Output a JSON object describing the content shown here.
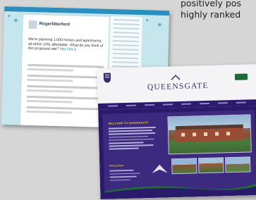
{
  "caption": {
    "line1": "positively pos",
    "line2": "highly ranked"
  },
  "twitter_page": {
    "handle": "Rogerlitterford",
    "tweet_main": "We're planning 1,000 homes and apartments, all within 10% affordable. What do you think of this proposed site?",
    "tweet_link": "http://bit.ly"
  },
  "queensgate_page": {
    "title": "QUEENSGATE",
    "welcome_heading": "WELCOME TO QUEENSGATE",
    "find_us": "Find us here",
    "colors": {
      "brand_purple": "#2b1a6e",
      "accent_yellow": "#f4d21f",
      "badge_green": "#1f6a38"
    }
  }
}
